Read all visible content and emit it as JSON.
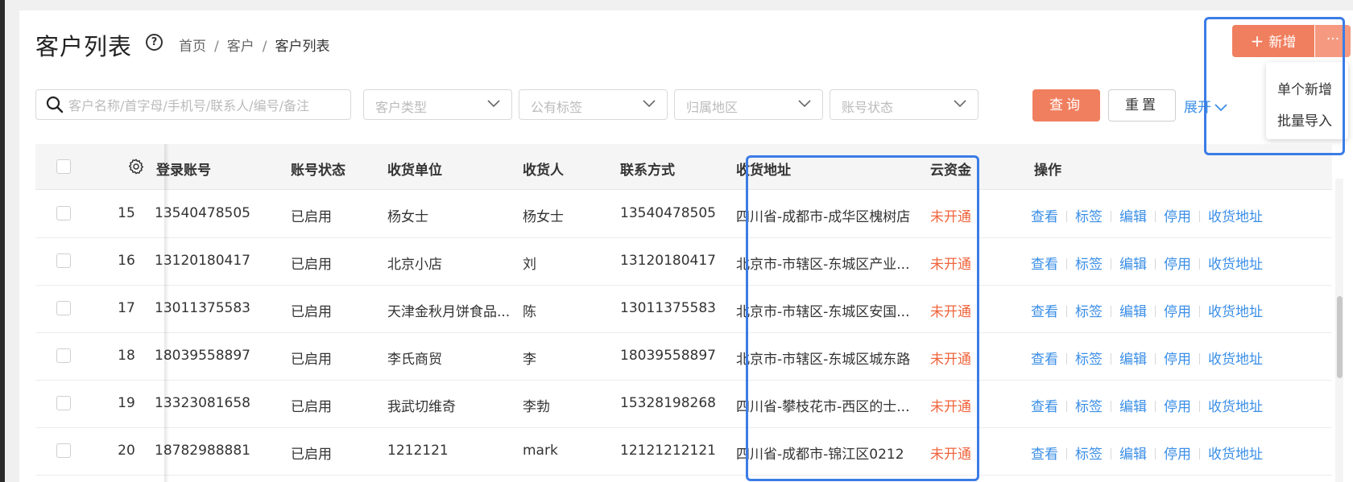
{
  "header": {
    "title": "客户列表",
    "help_icon": "?",
    "breadcrumb": [
      "首页",
      "客户",
      "客户列表"
    ],
    "breadcrumb_sep": "/"
  },
  "add_button": {
    "plus": "+",
    "label": "新增",
    "more": "···"
  },
  "dropdown": {
    "items": [
      "单个新增",
      "批量导入"
    ]
  },
  "filters": {
    "search_placeholder": "客户名称/首字母/手机号/联系人/编号/备注",
    "selects": [
      "客户类型",
      "公有标签",
      "归属地区",
      "账号状态"
    ],
    "query_label": "查询",
    "reset_label": "重置",
    "expand_label": "展开"
  },
  "table": {
    "columns": [
      "登录账号",
      "账号状态",
      "收货单位",
      "收货人",
      "联系方式",
      "收货地址",
      "云资金",
      "操作"
    ],
    "rows": [
      {
        "idx": "15",
        "account": "13540478505",
        "status": "已启用",
        "unit": "杨女士",
        "receiver": "杨女士",
        "phone": "13540478505",
        "address": "四川省-成都市-成华区槐树店",
        "fund": "未开通"
      },
      {
        "idx": "16",
        "account": "13120180417",
        "status": "已启用",
        "unit": "北京小店",
        "receiver": "刘",
        "phone": "13120180417",
        "address": "北京市-市辖区-东城区产业...",
        "fund": "未开通"
      },
      {
        "idx": "17",
        "account": "13011375583",
        "status": "已启用",
        "unit": "天津金秋月饼食品...",
        "receiver": "陈",
        "phone": "13011375583",
        "address": "北京市-市辖区-东城区安国...",
        "fund": "未开通"
      },
      {
        "idx": "18",
        "account": "18039558897",
        "status": "已启用",
        "unit": "李氏商贸",
        "receiver": "李",
        "phone": "18039558897",
        "address": "北京市-市辖区-东城区城东路",
        "fund": "未开通"
      },
      {
        "idx": "19",
        "account": "13323081658",
        "status": "已启用",
        "unit": "我武切维奇",
        "receiver": "李勃",
        "phone": "15328198268",
        "address": "四川省-攀枝花市-西区的士...",
        "fund": "未开通"
      },
      {
        "idx": "20",
        "account": "18782988881",
        "status": "已启用",
        "unit": "1212121",
        "receiver": "mark",
        "phone": "12121212121",
        "address": "四川省-成都市-锦江区0212",
        "fund": "未开通"
      }
    ],
    "actions": [
      "查看",
      "标签",
      "编辑",
      "停用",
      "收货地址"
    ]
  },
  "colors": {
    "accent": "#f07f5f",
    "link": "#3a8ee6",
    "danger": "#f0643c",
    "highlight": "#3b7ce6"
  }
}
